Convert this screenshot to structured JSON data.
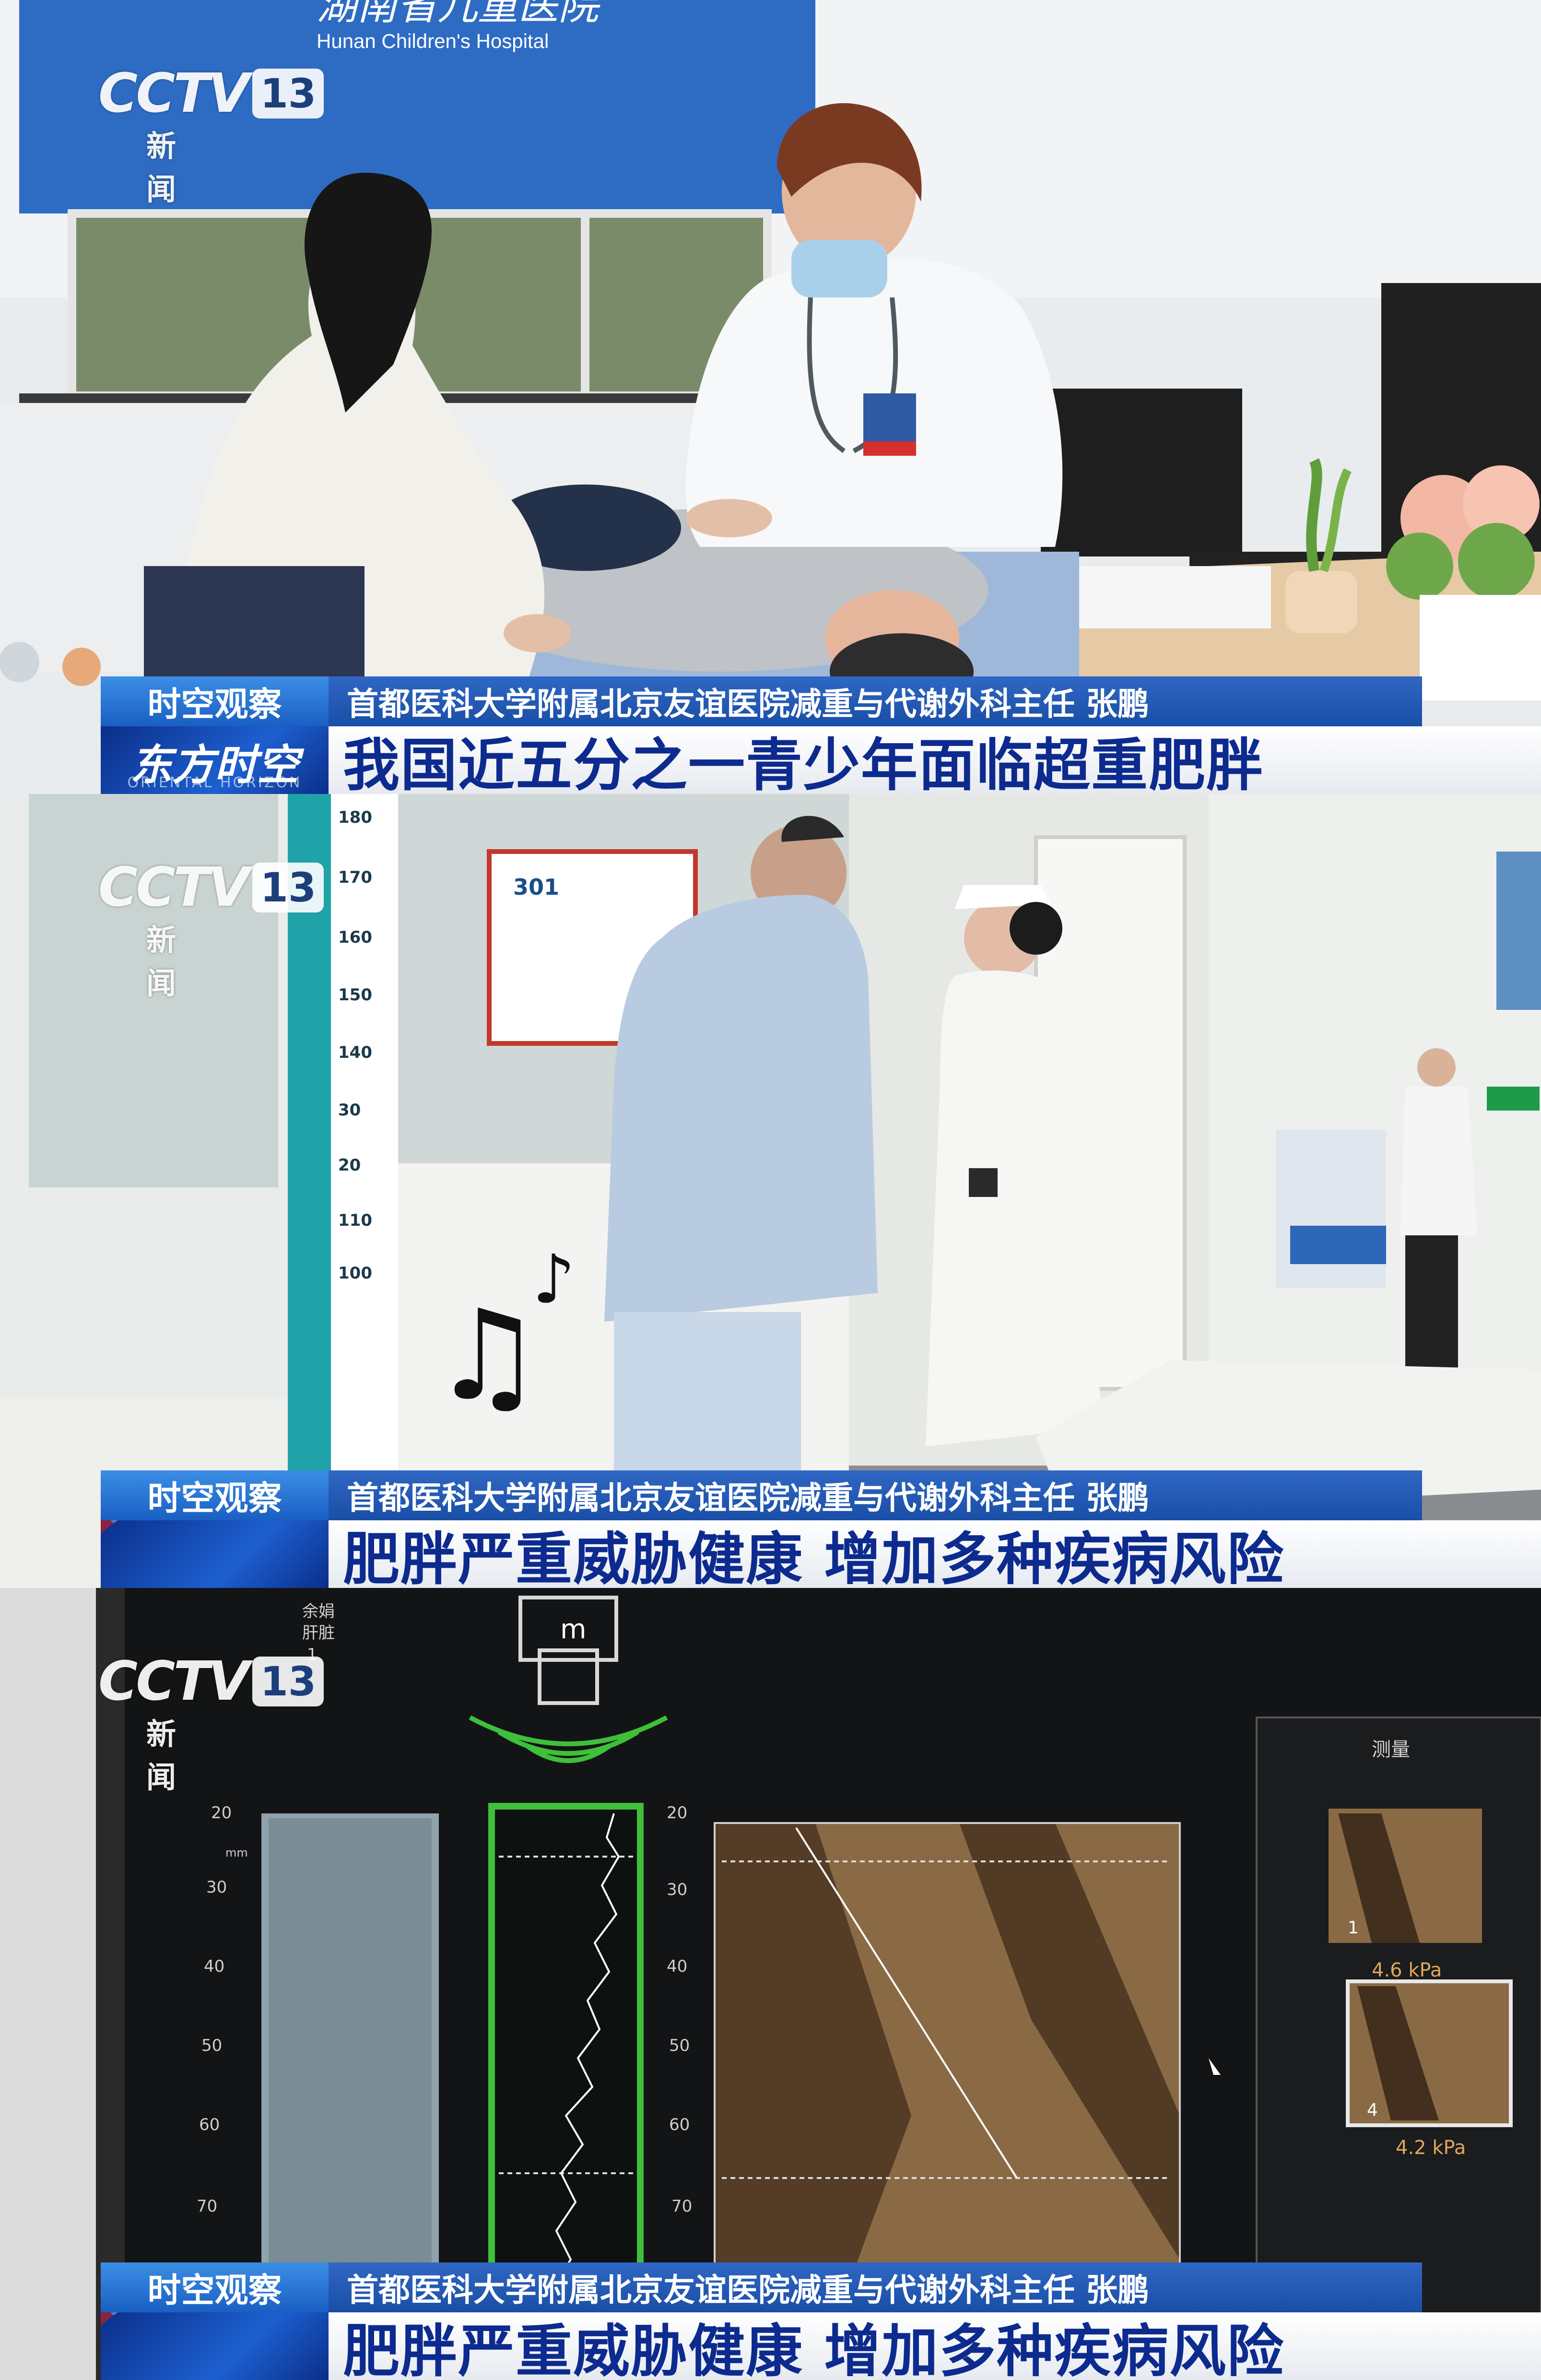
{
  "frames": [
    {
      "channel_logo": "CCTV",
      "channel_number": "13",
      "channel_subtitle": "新 闻",
      "column_tag": "时空观察",
      "speaker": "首都医科大学附属北京友谊医院减重与代谢外科主任 张鹏",
      "program_name": "东方时空",
      "program_name_en": "ORIENTAL HORIZON",
      "headline": "我国近五分之一青少年面临超重肥胖",
      "background_text": {
        "banner_cn": "湖南省儿童医院",
        "banner_en": "Hunan Children's Hospital"
      }
    },
    {
      "channel_logo": "CCTV",
      "channel_number": "13",
      "channel_subtitle": "新 闻",
      "column_tag": "时空观察",
      "speaker": "首都医科大学附属北京友谊医院减重与代谢外科主任 张鹏",
      "headline": "肥胖严重威胁健康  增加多种疾病风险",
      "background_text": {
        "height_scale": [
          "180",
          "170",
          "160",
          "150",
          "140",
          "30",
          "20",
          "110",
          "100"
        ],
        "wall_logo": "301"
      }
    },
    {
      "channel_logo": "CCTV",
      "channel_number": "13",
      "channel_subtitle": "新 闻",
      "column_tag": "时空观察",
      "speaker": "首都医科大学附属北京友谊医院减重与代谢外科主任 张鹏",
      "headline": "肥胖严重威胁健康  增加多种疾病风险",
      "screen": {
        "top_left": [
          "余娟",
          "肝脏",
          "1"
        ],
        "probe_label": "m",
        "unit": "mm",
        "left_axis": [
          "20",
          "30",
          "40",
          "50",
          "60",
          "70"
        ],
        "right_axis": [
          "20",
          "30",
          "40",
          "50",
          "60",
          "70"
        ],
        "panel_title": "测量",
        "measurements": [
          {
            "index": "1",
            "value": "4.6 kPa"
          },
          {
            "index": "4",
            "value": "4.2 kPa"
          }
        ]
      }
    }
  ],
  "colors": {
    "tag_blue": "#2a7de0",
    "speaker_blue": "#245bb8",
    "headline_text": "#0d2b8e",
    "monitor_green": "#3fbf3a"
  }
}
